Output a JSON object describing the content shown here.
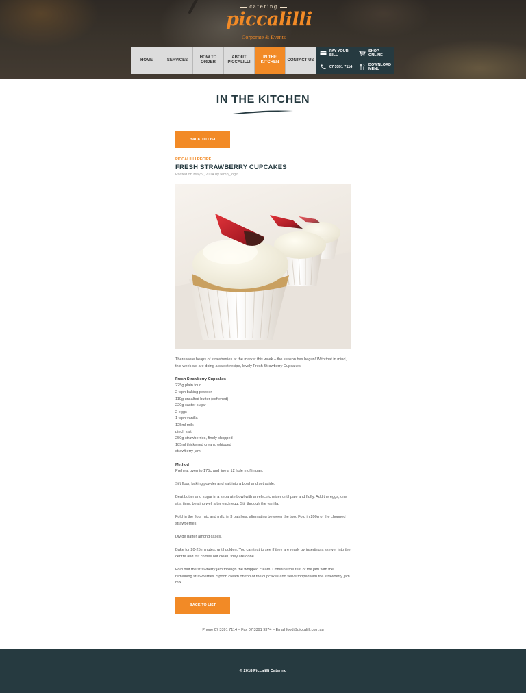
{
  "brand": {
    "top_text": "catering",
    "name": "piccalilli",
    "tagline": "Corporate & Events",
    "accent_color": "#f28a26",
    "dark_color": "#263a40"
  },
  "nav": {
    "items": [
      {
        "label": "HOME",
        "active": false
      },
      {
        "label": "SERVICES",
        "active": false
      },
      {
        "label": "HOW TO ORDER",
        "active": false
      },
      {
        "label": "ABOUT PICCALILLI",
        "active": false
      },
      {
        "label": "IN THE KITCHEN",
        "active": true
      },
      {
        "label": "CONTACT US",
        "active": false
      }
    ],
    "side": {
      "pay_bill": "PAY YOUR BILL",
      "shop_online": "SHOP ONLINE",
      "phone": "07 3391 7114",
      "download_menu": "DOWNLOAD MENU"
    }
  },
  "page": {
    "title": "IN THE KITCHEN",
    "back_label": "BACK TO LIST"
  },
  "post": {
    "category": "PICCALILLI RECIPE",
    "title": "FRESH STRAWBERRY CUPCAKES",
    "meta": "Posted on May 9, 2014 by temp_login",
    "intro": "There were heaps of strawberries at the market this week – the season has begun! With that in mind, this week we are doing a sweet recipe, lovely Fresh Strawberry Cupcakes.",
    "ingredients_heading": "Fresh Strawberry Cupcakes",
    "ingredients": [
      "225g plain four",
      "2 tspn baking powder",
      "110g unsalted butter (softened)",
      "220g caster sugar",
      "2 eggs",
      "1 tspn vanilla",
      "125ml milk",
      "pinch salt",
      "250g strawberries, finely chopped",
      "185ml thickened cream, whipped",
      "strawberry jam"
    ],
    "method_heading": "Method",
    "method_first": "Preheat oven to 175c and line a 12 hole muffin pan.",
    "method": [
      "Sift flour, baking powder and salt into a bowl and set aside.",
      "Beat butter and sugar in a separate bowl with an electric mixer until pale and fluffy. Add the eggs, one at a time, beating well after each egg. Stir through the vanilla.",
      "Fold in the flour mix and milk, in 3 batches, alternating between the two. Fold in 200g of the chopped strawberries.",
      "Divide batter among cases.",
      "Bake for 20-25 minutes, until golden. You can test to see if they are ready by inserting a skewer into the centre and if it comes out clean, they are done.",
      "Fold half the strawberry jam through the whipped cream. Combine the rest of the jam with the remaining strawberries. Spoon cream on top of the cupcakes and serve topped with the strawberry jam mix."
    ]
  },
  "contact": "Phone 07 3391 7114 – Fax 07 3391 9374 – Email food@piccalilli.com.au",
  "footer": {
    "copyright": "© 2018 Piccalilli Catering"
  }
}
